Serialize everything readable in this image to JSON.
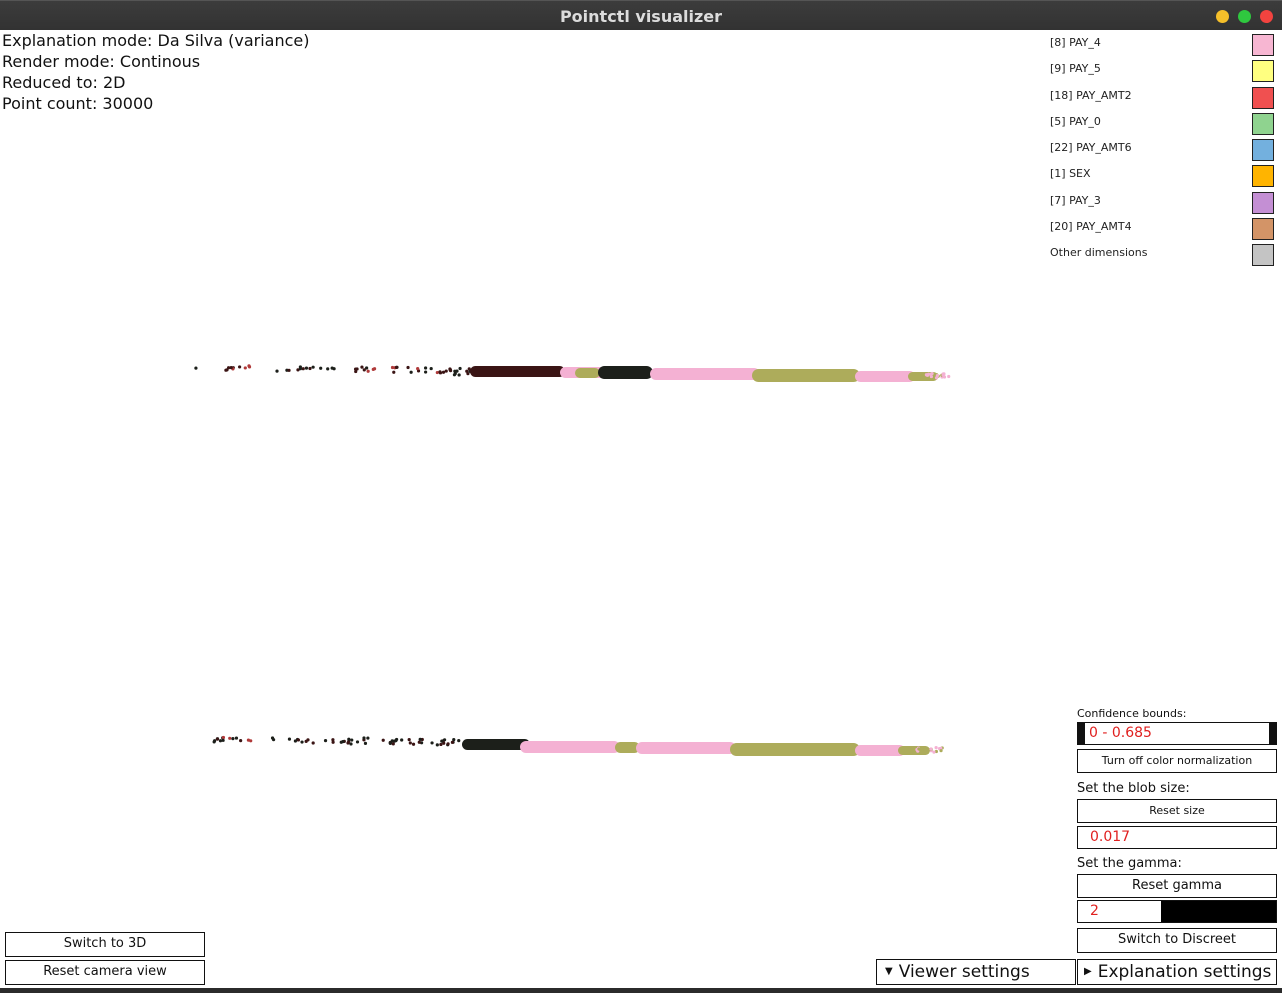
{
  "window": {
    "title": "Pointctl visualizer",
    "controls": {
      "minimize_color": "#f5bf2a",
      "maximize_color": "#2fc83f",
      "close_color": "#f2433f"
    }
  },
  "info": {
    "explanation_mode": "Explanation mode: Da Silva (variance)",
    "render_mode": "Render mode: Continous",
    "reduced_to": "Reduced to: 2D",
    "point_count": "Point count: 30000"
  },
  "legend": [
    {
      "label": "[8] PAY_4",
      "color": "#f7b6d2"
    },
    {
      "label": "[9] PAY_5",
      "color": "#ffff80"
    },
    {
      "label": "[18] PAY_AMT2",
      "color": "#f05050"
    },
    {
      "label": "[5] PAY_0",
      "color": "#8fd38f"
    },
    {
      "label": "[22] PAY_AMT6",
      "color": "#73b0de"
    },
    {
      "label": "[1] SEX",
      "color": "#ffb400"
    },
    {
      "label": "[7] PAY_3",
      "color": "#c48fd4"
    },
    {
      "label": "[20] PAY_AMT4",
      "color": "#d39467"
    },
    {
      "label": "Other dimensions",
      "color": "#c4c4c4"
    }
  ],
  "controls": {
    "confidence_label": "Confidence bounds:",
    "confidence_value": "0 - 0.685",
    "color_norm_button": "Turn off color normalization",
    "blob_label": "Set the blob size:",
    "reset_size_button": "Reset size",
    "blob_value": "0.017",
    "gamma_label": "Set the gamma:",
    "reset_gamma_button": "Reset gamma",
    "gamma_value": "2",
    "switch_discreet_button": "Switch to Discreet",
    "switch_3d_button": "Switch to 3D",
    "reset_camera_button": "Reset camera view",
    "viewer_settings": "Viewer settings",
    "explanation_settings": "Explanation settings"
  },
  "plot_colors": {
    "pink": "#f4b1d3",
    "olive": "#adac5b",
    "dark": "#1c1f1a",
    "darkred": "#3a1414",
    "red": "#b03a3a"
  }
}
